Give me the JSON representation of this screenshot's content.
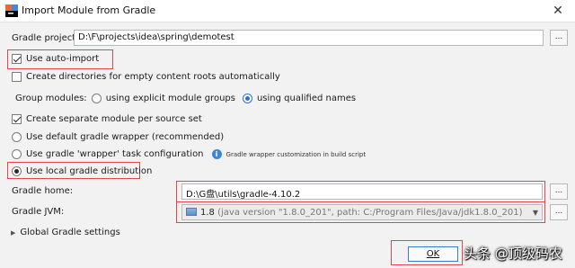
{
  "window": {
    "title": "Import Module from Gradle",
    "close_glyph": "✕"
  },
  "gradle_project": {
    "label": "Gradle project:",
    "value": "D:\\F\\projects\\idea\\spring\\demotest",
    "browse_label": "..."
  },
  "options": {
    "auto_import": {
      "label": "Use auto-import",
      "checked": true
    },
    "create_dirs": {
      "label": "Create directories for empty content roots automatically",
      "checked": false
    },
    "group_modules": {
      "label": "Group modules:",
      "explicit": {
        "label": "using explicit module groups",
        "checked": false
      },
      "qualified": {
        "label": "using qualified names",
        "checked": true
      }
    },
    "separate_module": {
      "label": "Create separate module per source set",
      "checked": true
    },
    "default_wrapper": {
      "label": "Use default gradle wrapper (recommended)",
      "checked": false
    },
    "wrapper_task": {
      "label": "Use gradle 'wrapper' task configuration",
      "checked": false,
      "hint": "Gradle wrapper customization in build script"
    },
    "local_distribution": {
      "label": "Use local gradle distribution",
      "checked": true
    }
  },
  "gradle_home": {
    "label": "Gradle home:",
    "value": "D:\\G盘\\utils\\gradle-4.10.2",
    "browse_label": "..."
  },
  "gradle_jvm": {
    "label": "Gradle JVM:",
    "version": "1.8",
    "detail": "(java version \"1.8.0_201\", path: C:/Program Files/Java/jdk1.8.0_201)",
    "browse_label": "..."
  },
  "global_settings": {
    "label": "Global Gradle settings"
  },
  "footer": {
    "ok_label": "OK"
  },
  "watermark": "头条 @顶级码农",
  "colors": {
    "highlight": "#e0484d",
    "accent": "#2a6fd1"
  }
}
